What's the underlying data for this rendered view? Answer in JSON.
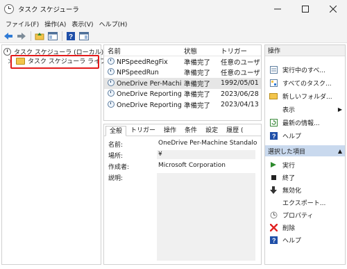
{
  "window": {
    "title": "タスク スケジューラ"
  },
  "menu": [
    "ファイル(F)",
    "操作(A)",
    "表示(V)",
    "ヘルプ(H)"
  ],
  "tree": {
    "root": "タスク スケジューラ (ローカル)",
    "child": "タスク スケジューラ ライブラリ"
  },
  "list": {
    "headers": [
      "名前",
      "状態",
      "トリガー"
    ],
    "rows": [
      [
        "NPSpeedRegFix",
        "準備完了",
        "任意のユーザ"
      ],
      [
        "NPSpeedRun",
        "準備完了",
        "任意のユーザ"
      ],
      [
        "OneDrive Per-Machi...",
        "準備完了",
        "1992/05/01"
      ],
      [
        "OneDrive Reporting ...",
        "準備完了",
        "2023/06/28"
      ],
      [
        "OneDrive Reporting ...",
        "準備完了",
        "2023/04/13"
      ]
    ]
  },
  "details": {
    "tabs": [
      "全般",
      "トリガー",
      "操作",
      "条件",
      "設定",
      "履歴 ("
    ],
    "name_label": "名前:",
    "name_value": "OneDrive Per-Machine Standalon",
    "location_label": "場所:",
    "location_value": "¥",
    "author_label": "作成者:",
    "author_value": "Microsoft Corporation",
    "description_label": "説明:"
  },
  "actions": {
    "header": "操作",
    "items": [
      "実行中のすべ...",
      "すべてのタスク...",
      "新しいフォルダ...",
      "表示",
      "最新の情報...",
      "ヘルプ"
    ],
    "section": "選択した項目",
    "selected_items": [
      "実行",
      "終了",
      "無効化",
      "エクスポート...",
      "プロパティ",
      "削除",
      "ヘルプ"
    ]
  },
  "colors": {
    "highlight": "#e21a1a",
    "section_bg": "#c9d9ee",
    "selected_row": "#e6e6e6"
  }
}
